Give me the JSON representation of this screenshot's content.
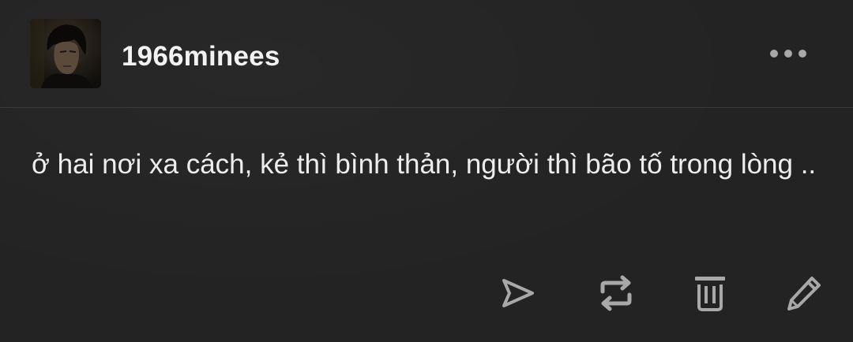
{
  "post": {
    "username": "1966minees",
    "body_text": "ở hai nơi xa cách, kẻ thì bình thản, người thì bão tố trong lòng .."
  },
  "header": {
    "more_icon": "ellipsis-horizontal-icon"
  },
  "actions": [
    {
      "icon": "send-icon"
    },
    {
      "icon": "reblog-icon"
    },
    {
      "icon": "trash-icon"
    },
    {
      "icon": "pencil-icon"
    }
  ],
  "colors": {
    "background": "#232323",
    "text": "#ededed",
    "icon": "#a8a8a8",
    "divider": "#3a3a3a"
  }
}
